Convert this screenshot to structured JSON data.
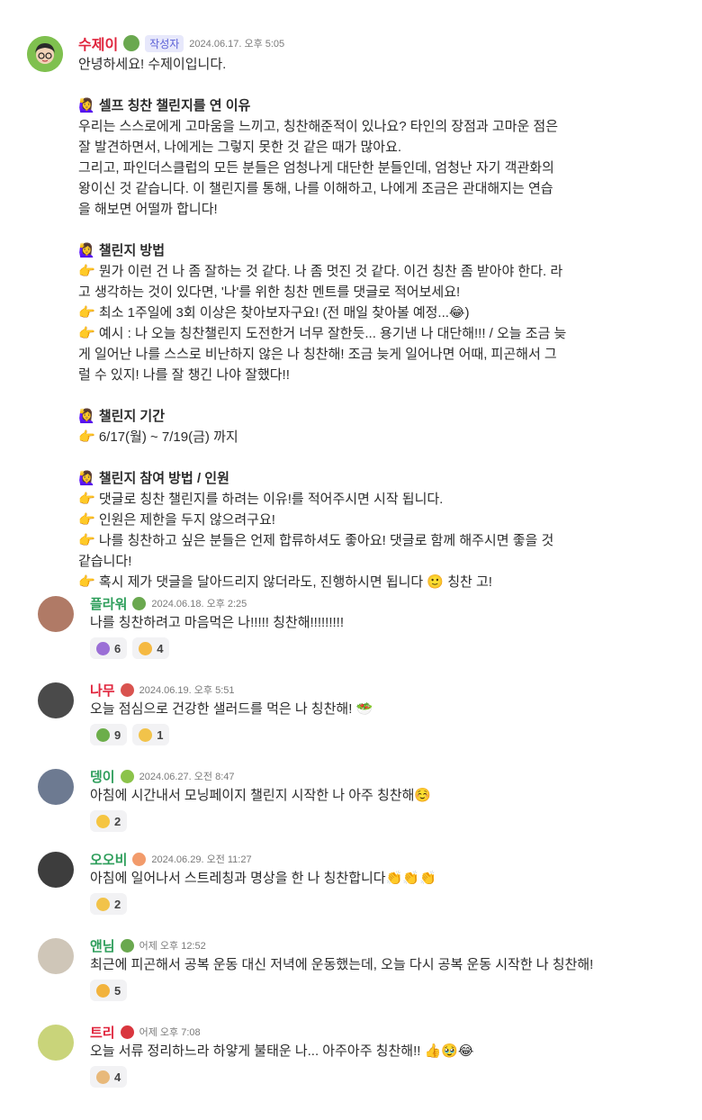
{
  "post": {
    "author": "수제이",
    "author_tag": "작성자",
    "timestamp": "2024.06.17. 오후 5:05",
    "lines": [
      {
        "text": "안녕하세요! 수제이입니다.",
        "bold": false
      },
      {
        "text": "",
        "bold": false
      },
      {
        "text": "🙋‍♀️ 셀프 칭찬 챌린지를 연 이유",
        "bold": true
      },
      {
        "text": "우리는 스스로에게 고마움을 느끼고, 칭찬해준적이 있나요? 타인의 장점과 고마운 점은",
        "bold": false
      },
      {
        "text": "잘 발견하면서, 나에게는 그렇지 못한 것 같은 때가 많아요.",
        "bold": false
      },
      {
        "text": "그리고, 파인더스클럽의 모든 분들은 엄청나게 대단한 분들인데, 엄청난 자기 객관화의",
        "bold": false
      },
      {
        "text": "왕이신 것 같습니다. 이 챌린지를 통해, 나를 이해하고, 나에게 조금은 관대해지는 연습",
        "bold": false
      },
      {
        "text": "을 해보면 어떨까 합니다!",
        "bold": false
      },
      {
        "text": "",
        "bold": false
      },
      {
        "text": "🙋‍♀️ 챌린지 방법",
        "bold": true
      },
      {
        "text": "👉 뭔가 이런 건 나 좀 잘하는 것 같다. 나 좀 멋진 것 같다. 이건 칭찬 좀 받아야 한다. 라",
        "bold": false
      },
      {
        "text": "고 생각하는 것이 있다면, '나'를 위한 칭찬 멘트를 댓글로 적어보세요!",
        "bold": false
      },
      {
        "text": "👉 최소 1주일에 3회 이상은 찾아보자구요! (전 매일 찾아볼 예정...😂)",
        "bold": false
      },
      {
        "text": "👉 예시 : 나 오늘 칭찬챌린지 도전한거 너무 잘한듯... 용기낸 나 대단해!!! / 오늘 조금 늦",
        "bold": false
      },
      {
        "text": "게 일어난 나를 스스로 비난하지 않은 나 칭찬해! 조금 늦게 일어나면 어때, 피곤해서 그",
        "bold": false
      },
      {
        "text": "럴 수 있지! 나를 잘 챙긴 나야 잘했다!!",
        "bold": false
      },
      {
        "text": "",
        "bold": false
      },
      {
        "text": "🙋‍♀️ 챌린지 기간",
        "bold": true
      },
      {
        "text": "👉 6/17(월) ~ 7/19(금) 까지",
        "bold": false
      },
      {
        "text": "",
        "bold": false
      },
      {
        "text": "🙋‍♀️ 챌린지 참여 방법 / 인원",
        "bold": true
      },
      {
        "text": "👉 댓글로 칭찬 챌린지를 하려는 이유!를 적어주시면 시작 됩니다.",
        "bold": false
      },
      {
        "text": "👉 인원은 제한을 두지 않으려구요!",
        "bold": false
      },
      {
        "text": "👉 나를 칭찬하고 싶은 분들은 언제 합류하셔도 좋아요! 댓글로 함께 해주시면 좋을 것",
        "bold": false
      },
      {
        "text": "같습니다!",
        "bold": false
      },
      {
        "text": "👉 혹시 제가 댓글을 달아드리지 않더라도, 진행하시면 됩니다 🙂 칭찬 고!",
        "bold": false
      }
    ]
  },
  "comments": [
    {
      "name": "플라워",
      "name_color": "#2e9e5b",
      "badge_color": "#6aa84f",
      "timestamp": "2024.06.18. 오후 2:25",
      "avatar_color": "#b07a66",
      "text": "나를 칭찬하려고 마음먹은 나!!!!! 칭찬해!!!!!!!!!",
      "reactions": [
        {
          "icon": "purple-heart-icon",
          "color": "#9b6fd6",
          "count": "6"
        },
        {
          "icon": "smiling-face-icon",
          "color": "#f5b942",
          "count": "4"
        }
      ]
    },
    {
      "name": "나무",
      "name_color": "#e0243c",
      "badge_color": "#d9534f",
      "timestamp": "2024.06.19. 오후 5:51",
      "avatar_color": "#4a4a4a",
      "text": "오늘 점심으로 건강한 샐러드를 먹은 나 칭찬해! 🥗",
      "reactions": [
        {
          "icon": "salad-icon",
          "color": "#6cae4a",
          "count": "9"
        },
        {
          "icon": "heart-hands-icon",
          "color": "#f2c34a",
          "count": "1"
        }
      ]
    },
    {
      "name": "뎅이",
      "name_color": "#2e9e5b",
      "badge_color": "#8bc34a",
      "timestamp": "2024.06.27. 오전 8:47",
      "avatar_color": "#6d7a91",
      "text": "아침에 시간내서 모닝페이지 챌린지 시작한 나 아주 칭찬해☺️",
      "reactions": [
        {
          "icon": "sun-icon",
          "color": "#f5c542",
          "count": "2"
        }
      ]
    },
    {
      "name": "오오비",
      "name_color": "#2e9e5b",
      "badge_color": "#f29b6b",
      "timestamp": "2024.06.29. 오전 11:27",
      "avatar_color": "#3d3d3d",
      "text": "아침에 일어나서 스트레칭과 명상을 한 나 칭찬합니다👏👏👏",
      "reactions": [
        {
          "icon": "heart-hands-icon",
          "color": "#f2c34a",
          "count": "2"
        }
      ]
    },
    {
      "name": "앤님",
      "name_color": "#2e9e5b",
      "badge_color": "#6aa84f",
      "timestamp": "어제 오후 12:52",
      "avatar_color": "#cfc6b8",
      "text": "최근에 피곤해서 공복 운동 대신 저녁에 운동했는데, 오늘 다시 공복 운동 시작한 나 칭찬해!",
      "reactions": [
        {
          "icon": "flexed-biceps-icon",
          "color": "#f2b33d",
          "count": "5"
        }
      ]
    },
    {
      "name": "트리",
      "name_color": "#e0243c",
      "badge_color": "#d9363e",
      "timestamp": "어제 오후 7:08",
      "avatar_color": "#c9d47a",
      "text": "오늘 서류 정리하느라 하얗게 불태운 나... 아주아주 칭찬해!! 👍🥹😂",
      "reactions": [
        {
          "icon": "thumbs-up-icon",
          "color": "#e8b97a",
          "count": "4"
        }
      ]
    }
  ],
  "colors": {
    "author_name": "#e0243c",
    "post_badge": "#6aa84f"
  }
}
